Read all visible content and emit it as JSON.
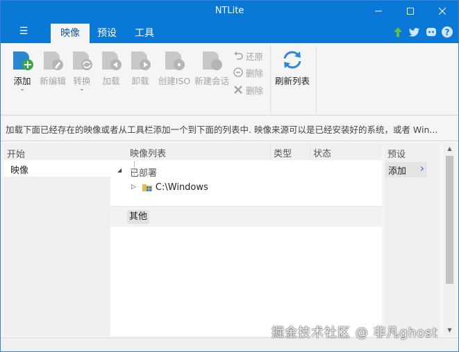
{
  "window": {
    "title": "NTLite"
  },
  "tabs": [
    {
      "label": "映像",
      "active": true
    },
    {
      "label": "预设",
      "active": false
    },
    {
      "label": "工具",
      "active": false
    }
  ],
  "social_icons": [
    "upgrade-arrow-icon",
    "twitter-icon",
    "discord-icon",
    "help-icon"
  ],
  "ribbon": {
    "add": "添加",
    "new_edit": "新编辑",
    "convert": "转换",
    "load": "加载",
    "unload": "卸载",
    "create_iso": "创建ISO",
    "new_session": "新建会话",
    "restore": "还原",
    "remove": "删除",
    "delete": "删除",
    "refresh": "刷新列表"
  },
  "info": {
    "text": "加载下面已经存在的映像或者从工具栏添加一个到下面的列表中. 映像来源可以是已经安装好的系统，或者 Win..."
  },
  "left": {
    "header": "开始",
    "item": "映像"
  },
  "list": {
    "columns": {
      "name": "映像列表",
      "type": "类型",
      "status": "状态"
    },
    "group_deployed": "已部署",
    "item_path": "C:\\Windows",
    "group_other": "其他"
  },
  "right": {
    "header": "预设",
    "add_label": "添加"
  },
  "watermark": "掘金技术社区 @ 非凡ghost",
  "colors": {
    "titlebar": "#0a78d7",
    "accent": "#1a6ed8",
    "disabled": "#a5a5a5"
  }
}
